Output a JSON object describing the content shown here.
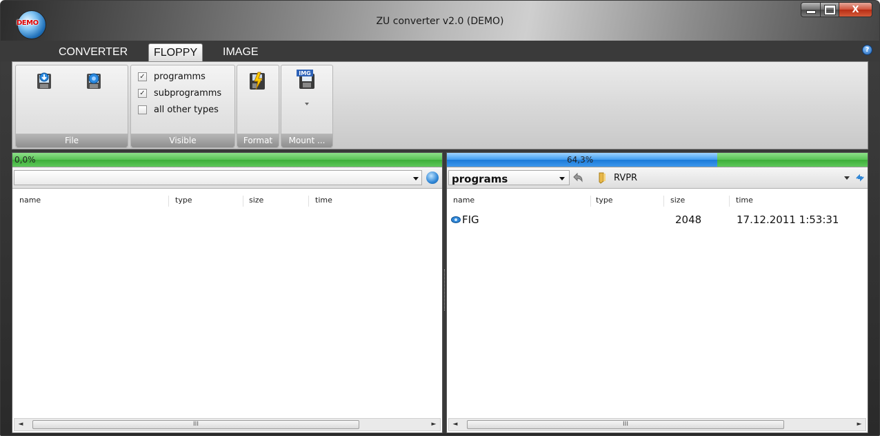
{
  "window": {
    "title": "ZU converter v2.0 (DEMO)",
    "badge": "DEMO"
  },
  "window_controls": {
    "close_label": "X"
  },
  "menu": {
    "tabs": [
      {
        "label": "CONVERTER"
      },
      {
        "label": "FLOPPY"
      },
      {
        "label": "IMAGE"
      }
    ],
    "active_tab": "FLOPPY",
    "help": "?"
  },
  "ribbon": {
    "file": {
      "label": "File"
    },
    "visible": {
      "label": "Visible",
      "options": [
        {
          "label": "programms",
          "checked": true
        },
        {
          "label": "subprogramms",
          "checked": true
        },
        {
          "label": "all other types",
          "checked": false
        }
      ]
    },
    "format": {
      "label": "Format"
    },
    "mount": {
      "label": "Mount ...",
      "icon_text": "IMG"
    }
  },
  "left_pane": {
    "progress_text": "0,0%",
    "progress": 0.0,
    "combo_value": "",
    "columns": [
      "name",
      "type",
      "size",
      "time"
    ],
    "rows": [],
    "scroll_grip": "III"
  },
  "right_pane": {
    "progress_text": "64,3%",
    "progress": 0.643,
    "combo_value": "programs",
    "path": "RVPR",
    "columns": [
      "name",
      "type",
      "size",
      "time"
    ],
    "rows": [
      {
        "name": "FIG",
        "type": "",
        "size": "2048",
        "time": "17.12.2011 1:53:31"
      }
    ],
    "scroll_grip": "III"
  },
  "colors": {
    "progress_green": "#58c354",
    "progress_blue": "#3f9cf0",
    "close_red": "#c9411f"
  }
}
